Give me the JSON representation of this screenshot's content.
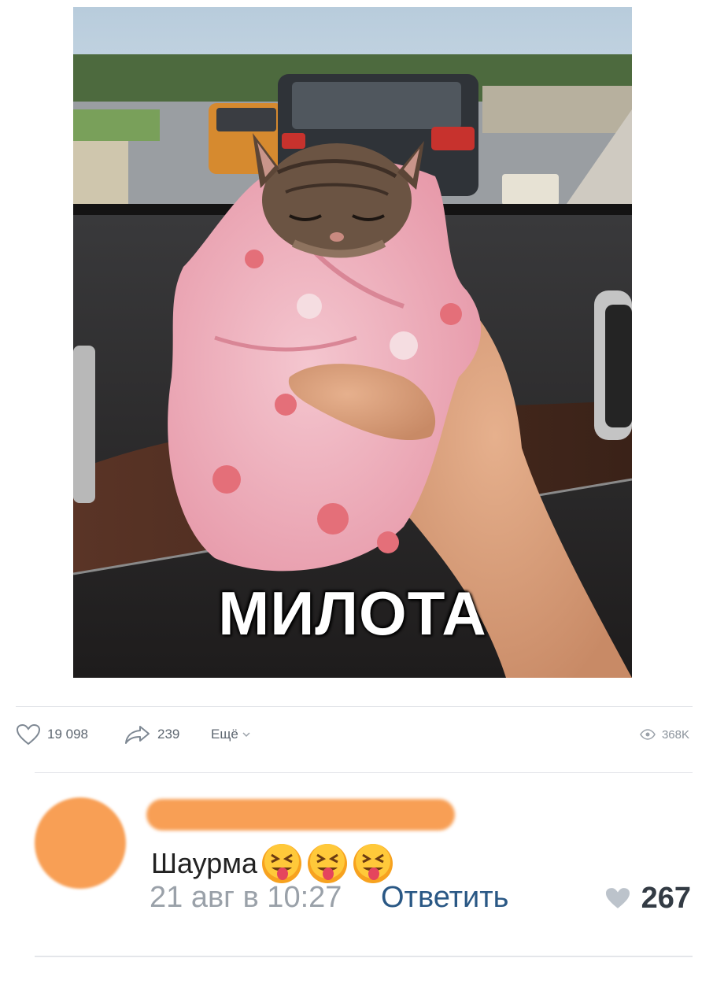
{
  "post": {
    "image_caption": "МИЛОТА",
    "stats": {
      "likes": "19 098",
      "reposts": "239",
      "more_label": "Ещё",
      "views": "368K"
    }
  },
  "comment": {
    "text": "Шаурма",
    "emoji": [
      "tongue-squint-emoji",
      "tongue-squint-emoji",
      "tongue-squint-emoji"
    ],
    "date": "21 авг в 10:27",
    "reply_label": "Ответить",
    "likes": "267"
  },
  "colors": {
    "redaction": "#f89f55",
    "link": "#2a5885",
    "muted": "#9aa1a9"
  }
}
